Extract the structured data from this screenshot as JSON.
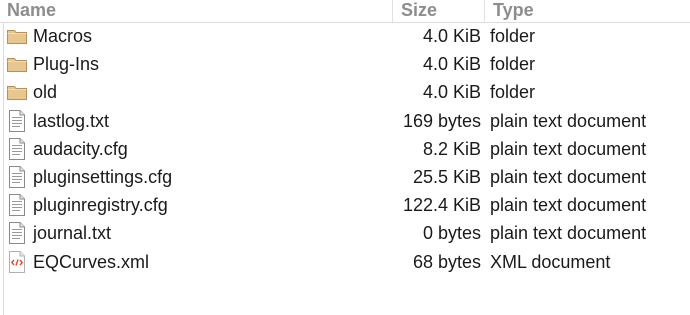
{
  "columns": {
    "name": "Name",
    "size": "Size",
    "type": "Type"
  },
  "files": [
    {
      "name": "Macros",
      "size": "4.0 KiB",
      "type": "folder",
      "icon": "folder-icon"
    },
    {
      "name": "Plug-Ins",
      "size": "4.0 KiB",
      "type": "folder",
      "icon": "folder-icon"
    },
    {
      "name": "old",
      "size": "4.0 KiB",
      "type": "folder",
      "icon": "folder-icon"
    },
    {
      "name": "lastlog.txt",
      "size": "169 bytes",
      "type": "plain text document",
      "icon": "text-file-icon"
    },
    {
      "name": "audacity.cfg",
      "size": "8.2 KiB",
      "type": "plain text document",
      "icon": "text-file-icon"
    },
    {
      "name": "pluginsettings.cfg",
      "size": "25.5 KiB",
      "type": "plain text document",
      "icon": "text-file-icon"
    },
    {
      "name": "pluginregistry.cfg",
      "size": "122.4 KiB",
      "type": "plain text document",
      "icon": "text-file-icon"
    },
    {
      "name": "journal.txt",
      "size": "0 bytes",
      "type": "plain text document",
      "icon": "text-file-icon"
    },
    {
      "name": "EQCurves.xml",
      "size": "68 bytes",
      "type": "XML document",
      "icon": "xml-file-icon"
    }
  ],
  "colors": {
    "folder_fill": "#e8c68f",
    "folder_stroke": "#b8915a",
    "xml_tag": "#d9502b",
    "header_text": "#8d8d8d"
  }
}
